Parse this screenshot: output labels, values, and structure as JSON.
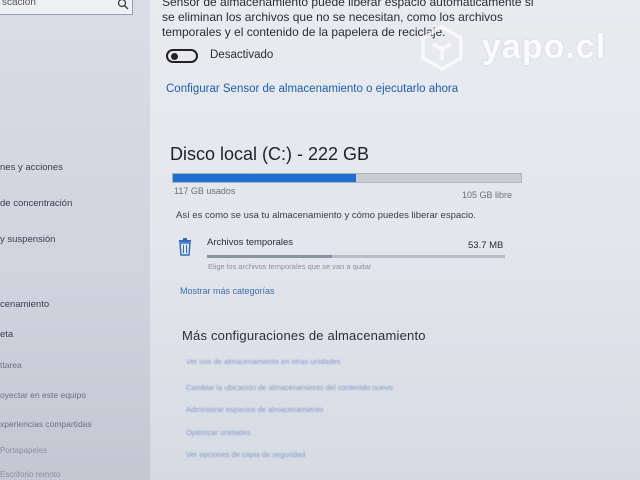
{
  "sidebar": {
    "search_placeholder": "scación",
    "items": [
      {
        "label": "nes y acciones"
      },
      {
        "label": "de concentración"
      },
      {
        "label": "y suspensión"
      },
      {
        "label": "cenamiento"
      },
      {
        "label": "eta"
      },
      {
        "label": "ttarea"
      },
      {
        "label": "oyectar en este equipo"
      },
      {
        "label": "xperiencias compartidas"
      },
      {
        "label": "Portapapeles"
      },
      {
        "label": "Escritorio remoto"
      }
    ]
  },
  "storage_sense": {
    "description": "Sensor de almacenamiento puede liberar espacio automáticamente si se eliminan los archivos que no se necesitan, como los archivos temporales y el contenido de la papelera de reciclaje.",
    "toggle_label": "Desactivado",
    "toggle_on": false,
    "configure_link": "Configurar Sensor de almacenamiento o ejecutarlo ahora"
  },
  "disk": {
    "title": "Disco local (C:) - 222 GB",
    "used_label": "117 GB usados",
    "free_label": "105 GB libre",
    "used_fraction": 0.527,
    "accent": "#1d6fd1",
    "usage_text": "Así es como se usa tu almacenamiento y cómo puedes liberar espacio."
  },
  "categories": [
    {
      "icon": "trash-icon",
      "label": "Archivos temporales",
      "size": "53.7 MB",
      "fraction": 0.42,
      "description": "Elige los archivos temporales que se van a quitar"
    }
  ],
  "more_categories_link": "Mostrar más categorías",
  "more_settings": {
    "title": "Más configuraciones de almacenamiento",
    "links": [
      "Ver uso de almacenamiento en otras unidades",
      "Cambiar la ubicación de almacenamiento del contenido nuevo",
      "Administrar espacios de almacenamiento",
      "Optimizar unidades",
      "Ver opciones de copia de seguridad"
    ]
  },
  "watermark": {
    "text": "yapo.cl"
  }
}
